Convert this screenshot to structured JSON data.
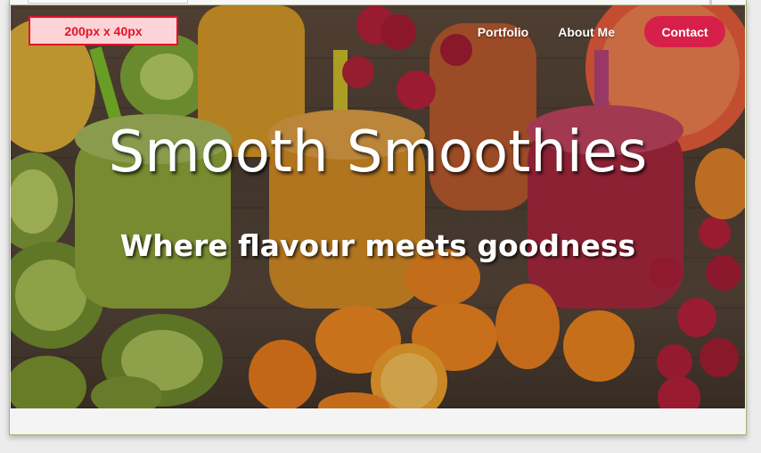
{
  "header": {
    "logo_placeholder": "200px x 40px",
    "nav": [
      {
        "label": "Portfolio"
      },
      {
        "label": "About Me"
      }
    ],
    "contact_label": "Contact"
  },
  "hero": {
    "title": "Smooth Smoothies",
    "subtitle": "Where flavour meets goodness"
  },
  "colors": {
    "accent": "#d6204a",
    "placeholder_border": "#e3132a",
    "placeholder_fill": "#fcd3d6"
  }
}
